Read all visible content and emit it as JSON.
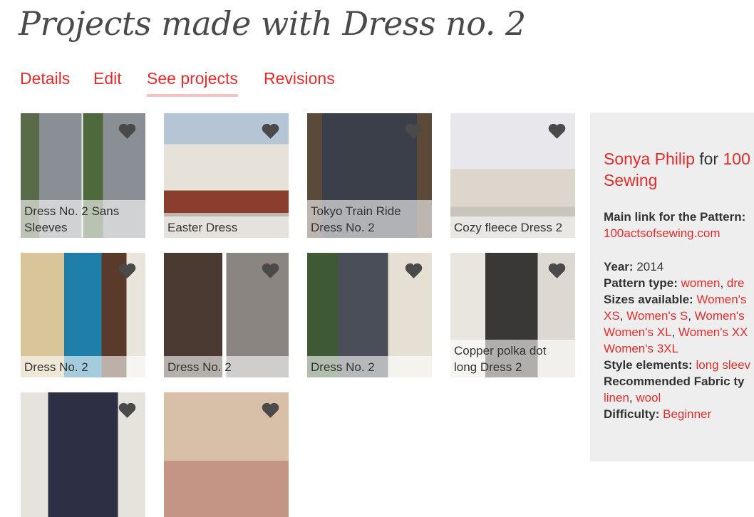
{
  "title": "Projects made with Dress no. 2",
  "tabs": [
    "Details",
    "Edit",
    "See projects",
    "Revisions"
  ],
  "projects": [
    {
      "caption": "Dress No. 2 Sans Sleeves"
    },
    {
      "caption": "Easter Dress"
    },
    {
      "caption": "Tokyo Train Ride Dress No. 2"
    },
    {
      "caption": "Cozy fleece Dress 2"
    },
    {
      "caption": "Dress No. 2"
    },
    {
      "caption": "Dress No. 2"
    },
    {
      "caption": "Dress No. 2"
    },
    {
      "caption": "Copper polka dot long Dress 2"
    },
    {
      "caption": ""
    },
    {
      "caption": ""
    }
  ],
  "sidebar": {
    "designer": "Sonya Philip",
    "for_word": "for",
    "publisher_line1": "100",
    "publisher_line2": "Sewing",
    "main_link_label": "Main link for the Pattern:",
    "main_link": "100actsofsewing.com",
    "year_label": "Year:",
    "year": "2014",
    "pattern_type_label": "Pattern type:",
    "pattern_type_1": "women",
    "pattern_type_2": "dre",
    "sizes_label": "Sizes available:",
    "sizes_line1_item": "Women's",
    "sizes_line2": [
      "XS",
      "Women's S",
      "Women's"
    ],
    "sizes_line3": [
      "Women's XL",
      "Women's XX"
    ],
    "sizes_line4": "Women's 3XL",
    "style_label": "Style elements:",
    "style_value": "long sleev",
    "fabric_label": "Recommended Fabric ty",
    "fabric_values": [
      "linen",
      "wool"
    ],
    "difficulty_label": "Difficulty:",
    "difficulty_value": "Beginner"
  },
  "colors": {
    "link": "#e32b2b",
    "sidebar_bg": "#eeeeee",
    "tab_underline": "#f3c3c3",
    "heart": "#4a4a4a"
  },
  "icons": {
    "card_heart": "heart-icon"
  }
}
